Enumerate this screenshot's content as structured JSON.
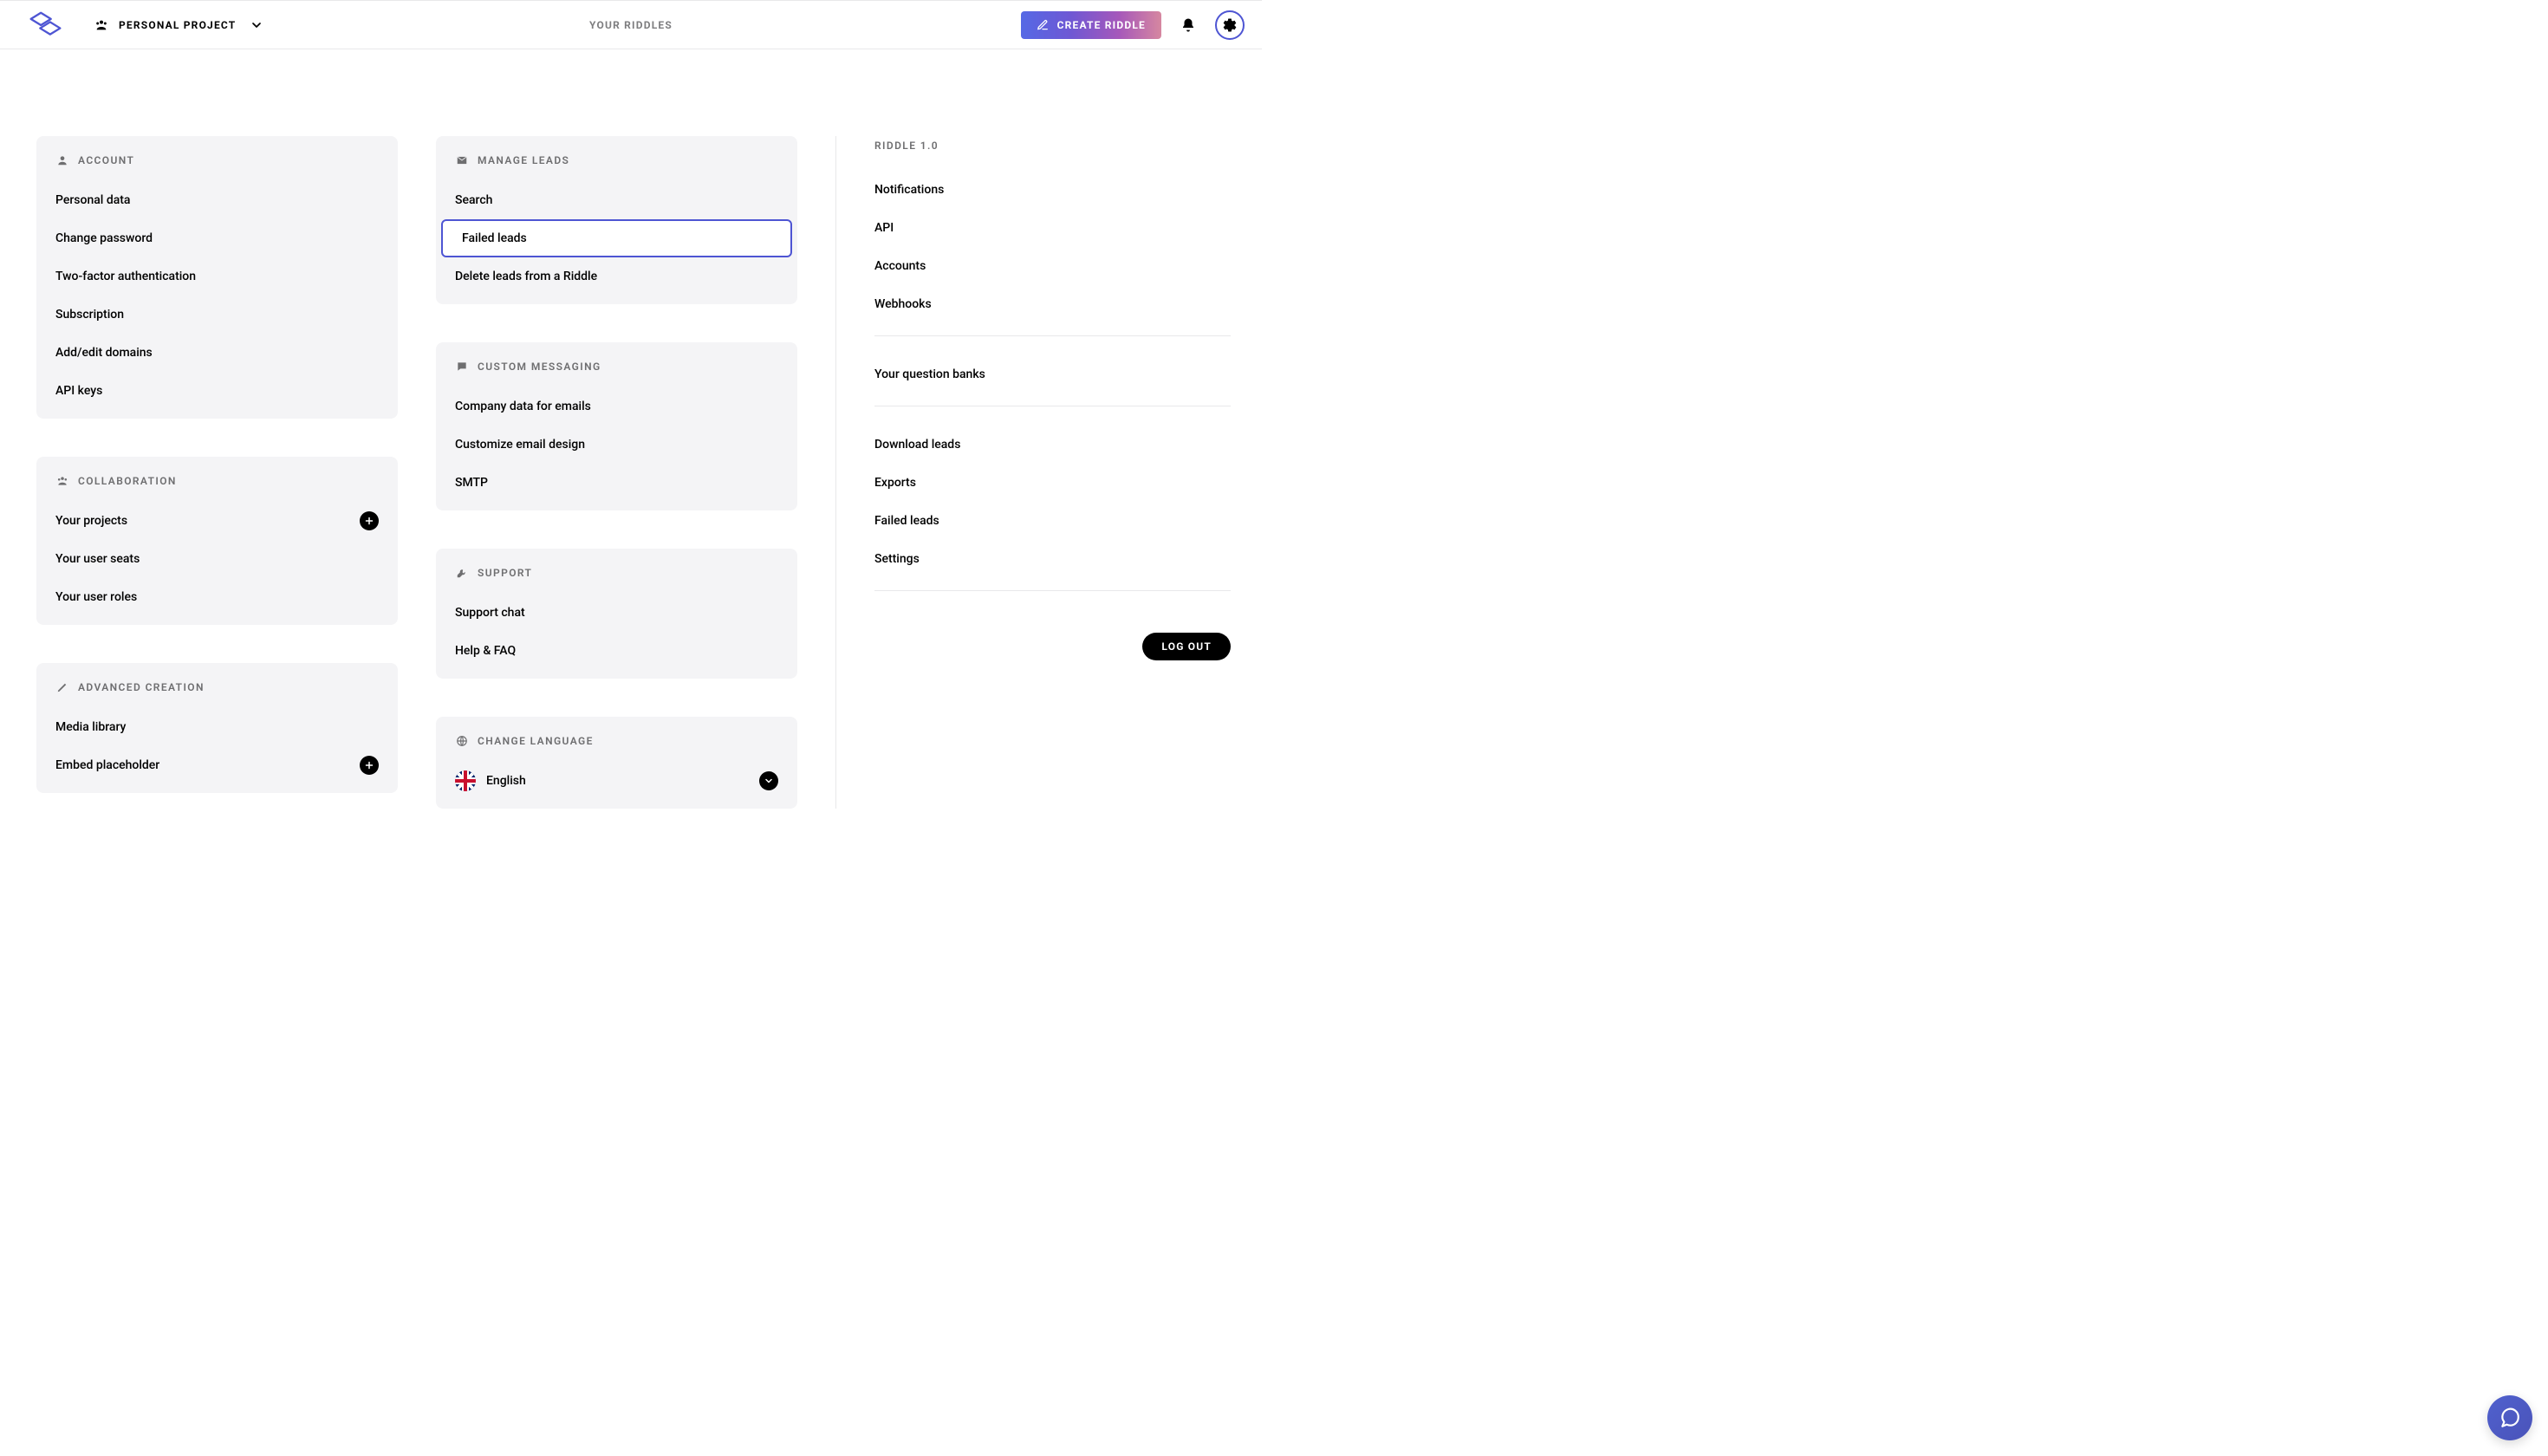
{
  "header": {
    "team_label": "PERSONAL PROJECT",
    "center_label": "YOUR RIDDLES",
    "create_label": "CREATE RIDDLE"
  },
  "account": {
    "title": "ACCOUNT",
    "items": [
      "Personal data",
      "Change password",
      "Two-factor authentication",
      "Subscription",
      "Add/edit domains",
      "API keys"
    ]
  },
  "collaboration": {
    "title": "COLLABORATION",
    "items": [
      "Your projects",
      "Your user seats",
      "Your user roles"
    ],
    "plus_index": 0
  },
  "advanced": {
    "title": "ADVANCED CREATION",
    "items": [
      "Media library",
      "Embed placeholder"
    ],
    "plus_index": 1
  },
  "leads": {
    "title": "MANAGE LEADS",
    "items": [
      "Search",
      "Failed leads",
      "Delete leads from a Riddle"
    ],
    "active_index": 1
  },
  "messaging": {
    "title": "CUSTOM MESSAGING",
    "items": [
      "Company data for emails",
      "Customize email design",
      "SMTP"
    ]
  },
  "support": {
    "title": "SUPPORT",
    "items": [
      "Support chat",
      "Help & FAQ"
    ]
  },
  "language": {
    "title": "CHANGE LANGUAGE",
    "selected": "English"
  },
  "right": {
    "title": "RIDDLE 1.0",
    "group1": [
      "Notifications",
      "API",
      "Accounts",
      "Webhooks"
    ],
    "group2": [
      "Your question banks"
    ],
    "group3": [
      "Download leads",
      "Exports",
      "Failed leads",
      "Settings"
    ],
    "logout_label": "LOG OUT"
  }
}
